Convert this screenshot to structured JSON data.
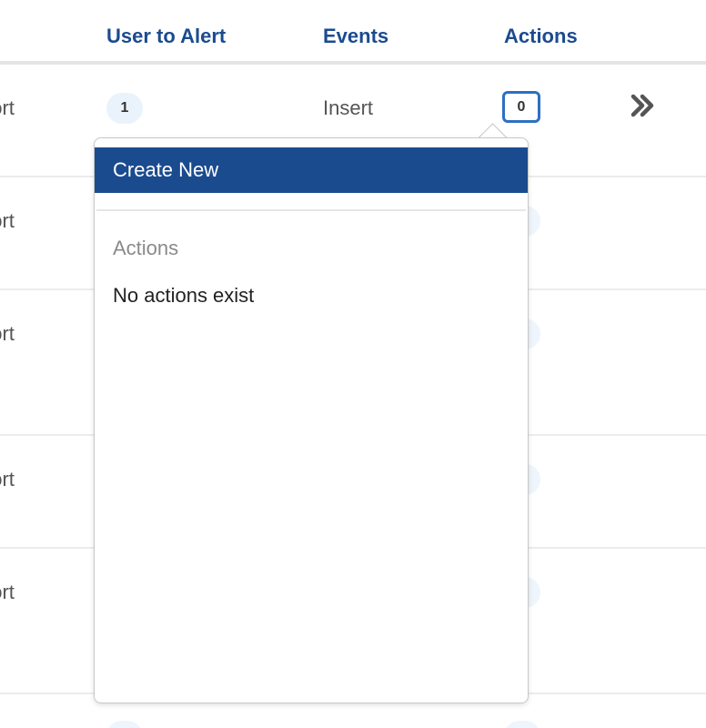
{
  "table": {
    "columns": {
      "user_to_alert": "User to Alert",
      "events": "Events",
      "actions": "Actions"
    },
    "rows": [
      {
        "partial_label": "port",
        "user_count": "1",
        "event": "Insert",
        "action_count": "0"
      },
      {
        "partial_label": "port"
      },
      {
        "partial_label": "port"
      },
      {
        "partial_label": "port"
      },
      {
        "partial_label": "port"
      }
    ]
  },
  "popover": {
    "create_new_label": "Create New",
    "section_label": "Actions",
    "empty_message": "No actions exist"
  },
  "colors": {
    "accent": "#1b4b8f",
    "badge_border": "#2e6fc4",
    "pill_bg": "#eaf3fb"
  },
  "icons": {
    "expand": "double-chevron-right-icon"
  }
}
